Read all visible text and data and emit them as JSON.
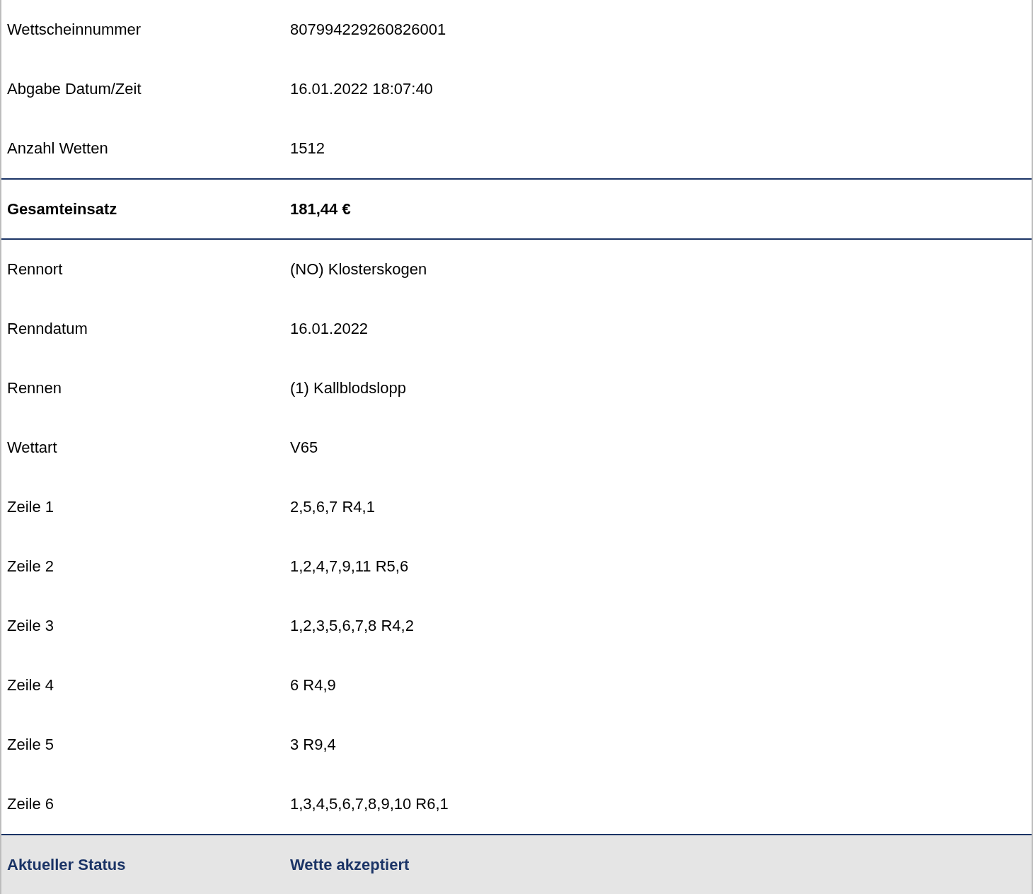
{
  "rows": [
    {
      "kind": "normal",
      "label": "Wettscheinnummer",
      "value": "807994229260826001"
    },
    {
      "kind": "normal",
      "label": "Abgabe Datum/Zeit",
      "value": "16.01.2022 18:07:40"
    },
    {
      "kind": "normal",
      "label": "Anzahl Wetten",
      "value": "1512"
    },
    {
      "kind": "total",
      "label": "Gesamteinsatz",
      "value": "181,44 €"
    },
    {
      "kind": "normal",
      "label": "Rennort",
      "value": "(NO) Klosterskogen"
    },
    {
      "kind": "normal",
      "label": "Renndatum",
      "value": "16.01.2022"
    },
    {
      "kind": "normal",
      "label": "Rennen",
      "value": "(1) Kallblodslopp"
    },
    {
      "kind": "normal",
      "label": "Wettart",
      "value": "V65"
    },
    {
      "kind": "normal",
      "label": "Zeile 1",
      "value": "2,5,6,7 R4,1"
    },
    {
      "kind": "normal",
      "label": "Zeile 2",
      "value": "1,2,4,7,9,11 R5,6"
    },
    {
      "kind": "normal",
      "label": "Zeile 3",
      "value": "1,2,3,5,6,7,8 R4,2"
    },
    {
      "kind": "normal",
      "label": "Zeile 4",
      "value": "6 R4,9"
    },
    {
      "kind": "normal",
      "label": "Zeile 5",
      "value": "3 R9,4"
    },
    {
      "kind": "normal",
      "label": "Zeile 6",
      "value": "1,3,4,5,6,7,8,9,10 R6,1"
    },
    {
      "kind": "status",
      "label": "Aktueller Status",
      "value": "Wette akzeptiert"
    }
  ]
}
